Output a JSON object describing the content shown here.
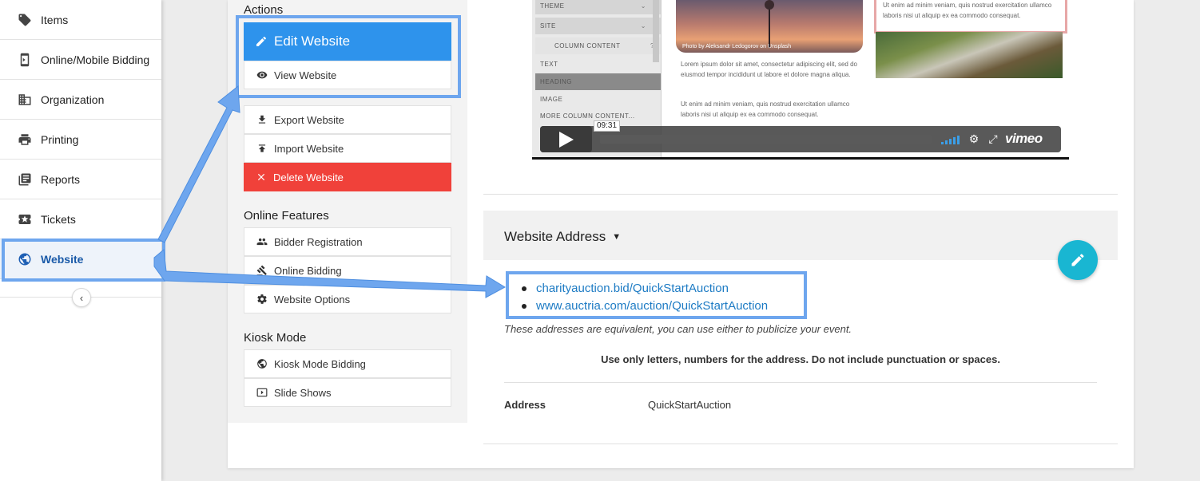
{
  "sidebar": {
    "items": [
      {
        "label": "Items",
        "icon": "tag-icon"
      },
      {
        "label": "Online/Mobile Bidding",
        "icon": "mobile-icon"
      },
      {
        "label": "Organization",
        "icon": "building-icon"
      },
      {
        "label": "Printing",
        "icon": "printer-icon"
      },
      {
        "label": "Reports",
        "icon": "reports-icon"
      },
      {
        "label": "Tickets",
        "icon": "ticket-icon"
      },
      {
        "label": "Website",
        "icon": "globe-icon",
        "active": true
      }
    ],
    "collapse_icon": "chevron-left-icon"
  },
  "actions": {
    "title": "Actions",
    "edit_label": "Edit Website",
    "view_label": "View Website",
    "export_label": "Export Website",
    "import_label": "Import Website",
    "delete_label": "Delete Website"
  },
  "online_features": {
    "title": "Online Features",
    "bidder_registration": "Bidder Registration",
    "online_bidding": "Online Bidding",
    "website_options": "Website Options"
  },
  "kiosk": {
    "title": "Kiosk Mode",
    "kiosk_bidding": "Kiosk Mode Bidding",
    "slide_shows": "Slide Shows"
  },
  "preview": {
    "editor_rows": {
      "theme": "THEME",
      "site": "SITE",
      "column_content": "COLUMN CONTENT",
      "text": "TEXT",
      "heading": "HEADING",
      "image": "IMAGE",
      "more": "MORE COLUMN CONTENT..."
    },
    "photo_credit": "Photo by Aleksandr Ledogorov on Unsplash",
    "lorem_1": "Lorem ipsum dolor sit amet, consectetur adipiscing elit, sed do eiusmod tempor incididunt ut labore et dolore magna aliqua.",
    "lorem_2": "Ut enim ad minim veniam, quis nostrud exercitation ullamco laboris nisi ut aliquip ex ea commodo consequat.",
    "lorem_3": "Ut enim ad minim veniam, quis nostrud exercitation ullamco laboris nisi ut aliquip ex ea commodo consequat.",
    "video_time": "09:31",
    "video_brand": "vimeo"
  },
  "website_address": {
    "title": "Website Address",
    "urls": [
      "charityauction.bid/QuickStartAuction",
      "www.auctria.com/auction/QuickStartAuction"
    ],
    "note": "These addresses are equivalent, you can use either to publicize your event.",
    "rule": "Use only letters, numbers for the address. Do not include punctuation or spaces.",
    "address_label": "Address",
    "address_value": "QuickStartAuction"
  },
  "colors": {
    "primary": "#2e93ec",
    "danger": "#f0413a",
    "fab": "#19b6d2",
    "callout": "#6ea6ee",
    "link": "#1d7bc4"
  }
}
